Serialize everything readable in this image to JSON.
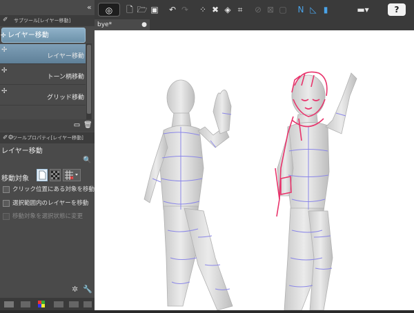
{
  "sub_tool": {
    "title": "サブツール[レイヤー移動]",
    "group_tab": "レイヤー移動",
    "items": [
      {
        "label": "レイヤー移動",
        "selected": true
      },
      {
        "label": "トーン柄移動",
        "selected": false
      },
      {
        "label": "グリッド移動",
        "selected": false
      }
    ]
  },
  "tool_property": {
    "title": "ツールプロパティ[レイヤー移動]",
    "tool_name": "レイヤー移動",
    "target_label": "移動対象",
    "options": [
      {
        "label": "クリック位置にある対象を移動",
        "enabled": true
      },
      {
        "label": "選択範囲内のレイヤーを移動",
        "enabled": true
      },
      {
        "label": "移動対象を選択状態に変更",
        "enabled": false
      }
    ]
  },
  "document": {
    "tab_label": "bye*"
  },
  "colors": {
    "accent": "#4aa3e8",
    "selection": "#6d92aa",
    "figure_lines": "#8a86e8",
    "character_lines": "#e8336b"
  }
}
